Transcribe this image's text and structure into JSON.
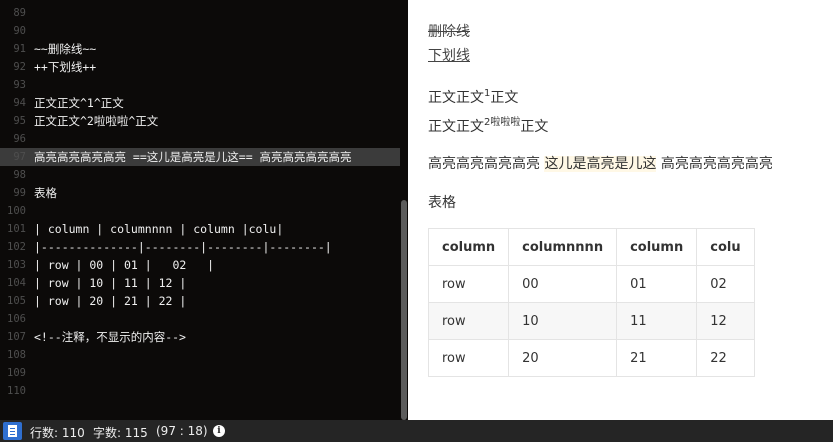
{
  "editor": {
    "lines": [
      {
        "n": "89",
        "text": ""
      },
      {
        "n": "90",
        "text": ""
      },
      {
        "n": "91",
        "text": "~~删除线~~"
      },
      {
        "n": "92",
        "text": "++下划线++"
      },
      {
        "n": "93",
        "text": ""
      },
      {
        "n": "94",
        "text": "正文正文^1^正文"
      },
      {
        "n": "95",
        "text": "正文正文^2啦啦啦^正文"
      },
      {
        "n": "96",
        "text": ""
      },
      {
        "n": "97",
        "text": "高亮高亮高亮高亮 ==这儿是高亮是儿这== 高亮高亮高亮高亮"
      },
      {
        "n": "98",
        "text": ""
      },
      {
        "n": "99",
        "text": "表格"
      },
      {
        "n": "100",
        "text": ""
      },
      {
        "n": "101",
        "text": "| column | columnnnn | column |colu|"
      },
      {
        "n": "102",
        "text": "|--------------|--------|--------|--------|"
      },
      {
        "n": "103",
        "text": "| row | 00 | 01 |   02   |"
      },
      {
        "n": "104",
        "text": "| row | 10 | 11 | 12 |"
      },
      {
        "n": "105",
        "text": "| row | 20 | 21 | 22 |"
      },
      {
        "n": "106",
        "text": ""
      },
      {
        "n": "107",
        "text": "<!--注释，不显示的内容-->"
      },
      {
        "n": "108",
        "text": ""
      },
      {
        "n": "109",
        "text": ""
      },
      {
        "n": "110",
        "text": ""
      }
    ],
    "highlight_line": "97"
  },
  "preview": {
    "strike": "删除线",
    "underline": "下划线",
    "sup1": {
      "before": "正文正文",
      "sup": "1",
      "after": "正文"
    },
    "sup2": {
      "before": "正文正文",
      "sup": "2啦啦啦",
      "after": "正文"
    },
    "highlight": {
      "before": "高亮高亮高亮高亮 ",
      "mark": "这儿是高亮是儿这",
      "after": " 高亮高亮高亮高亮"
    },
    "table_heading": "表格",
    "table": {
      "headers": [
        "column",
        "columnnnn",
        "column",
        "colu"
      ],
      "rows": [
        [
          "row",
          "00",
          "01",
          "02"
        ],
        [
          "row",
          "10",
          "11",
          "12"
        ],
        [
          "row",
          "20",
          "21",
          "22"
        ]
      ]
    }
  },
  "status": {
    "lines": "行数: 110",
    "chars": "字数: 115",
    "cursor": "(97 : 18)",
    "info_icon_glyph": "i"
  }
}
